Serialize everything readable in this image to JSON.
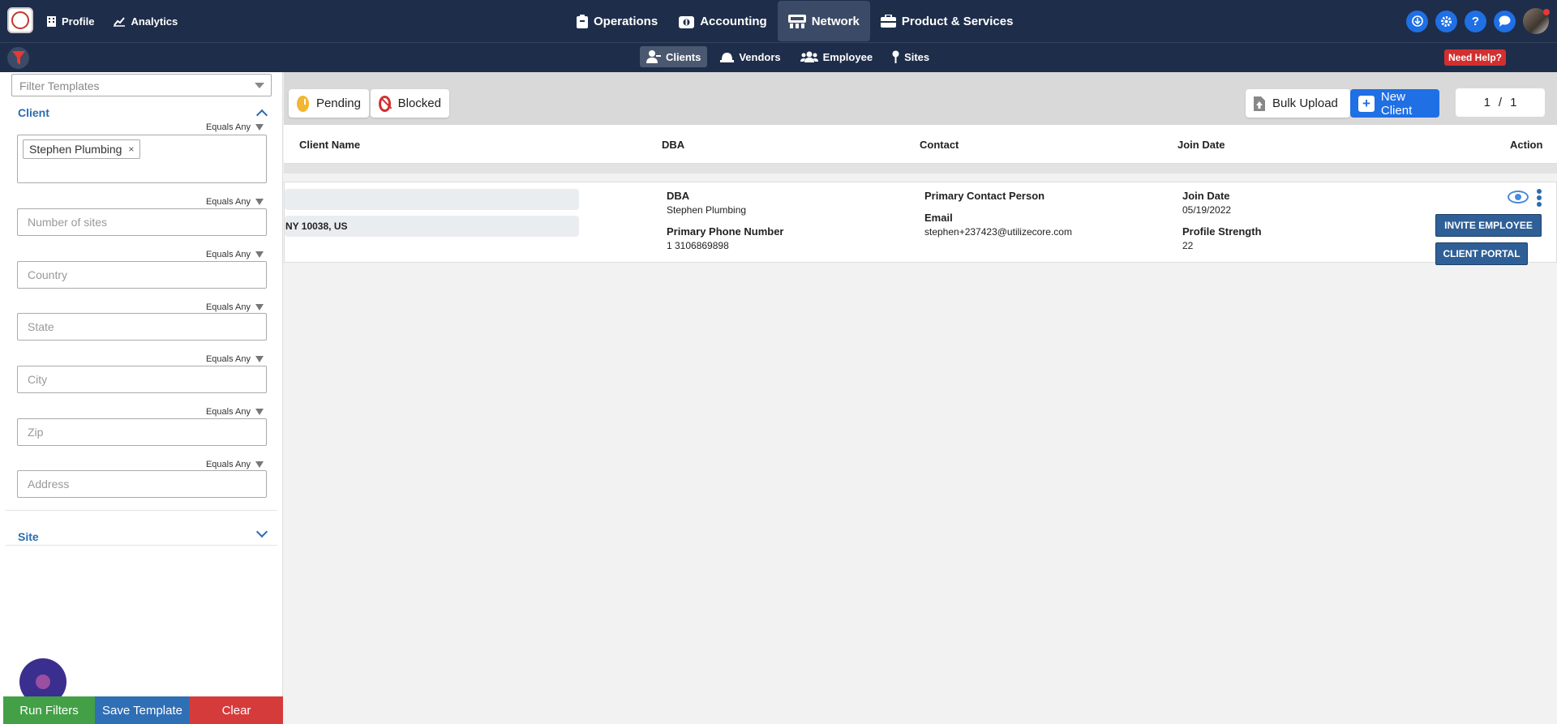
{
  "topnav": {
    "left": [
      {
        "label": "Profile",
        "icon": "building-icon"
      },
      {
        "label": "Analytics",
        "icon": "chart-line-icon"
      }
    ],
    "center": [
      {
        "label": "Operations",
        "icon": "clipboard-icon"
      },
      {
        "label": "Accounting",
        "icon": "money-icon"
      },
      {
        "label": "Network",
        "icon": "network-icon",
        "active": true
      },
      {
        "label": "Product & Services",
        "icon": "briefcase-icon"
      }
    ],
    "right_icons": [
      "download-icon",
      "gear-icon",
      "help-icon",
      "chat-icon"
    ],
    "help_glyph": "?"
  },
  "subnav": {
    "items": [
      {
        "label": "Clients",
        "icon": "user-tie-icon",
        "active": true
      },
      {
        "label": "Vendors",
        "icon": "hardhat-icon"
      },
      {
        "label": "Employee",
        "icon": "users-icon"
      },
      {
        "label": "Sites",
        "icon": "pin-icon"
      }
    ],
    "need_help": "Need Help?"
  },
  "sidebar": {
    "template_placeholder": "Filter Templates",
    "client_title": "Client",
    "site_title": "Site",
    "equals_label": "Equals Any",
    "selected_chip": "Stephen Plumbing",
    "chip_remove": "×",
    "fields": [
      "Number of sites",
      "Country",
      "State",
      "City",
      "Zip",
      "Address"
    ],
    "buttons": {
      "run": "Run Filters",
      "save": "Save Template",
      "clear": "Clear"
    }
  },
  "toolbar": {
    "pending": "Pending",
    "blocked": "Blocked",
    "bulk_upload": "Bulk Upload",
    "new_client": "New Client",
    "page_current": "1",
    "page_sep": "/",
    "page_total": "1"
  },
  "table": {
    "headers": [
      "Client Name",
      "DBA",
      "Contact",
      "Join Date",
      "Action"
    ]
  },
  "row": {
    "address_fragment": "NY 10038, US",
    "dba_label": "DBA",
    "dba_value": "Stephen Plumbing",
    "phone_label": "Primary Phone Number",
    "phone_value": "1 3106869898",
    "contact_label": "Primary Contact Person",
    "email_label": "Email",
    "email_value": "stephen+237423@utilizecore.com",
    "join_label": "Join Date",
    "join_value": "05/19/2022",
    "strength_label": "Profile Strength",
    "strength_value": "22",
    "invite_btn": "INVITE EMPLOYEE",
    "portal_btn": "CLIENT PORTAL"
  },
  "colors": {
    "nav_bg": "#1e2d4a",
    "accent_blue": "#1f6fe5",
    "section_blue": "#2a6cb0",
    "run_green": "#43a047",
    "save_blue": "#2f6fb5",
    "clear_red": "#d63b3b",
    "help_red": "#d32f2f"
  }
}
